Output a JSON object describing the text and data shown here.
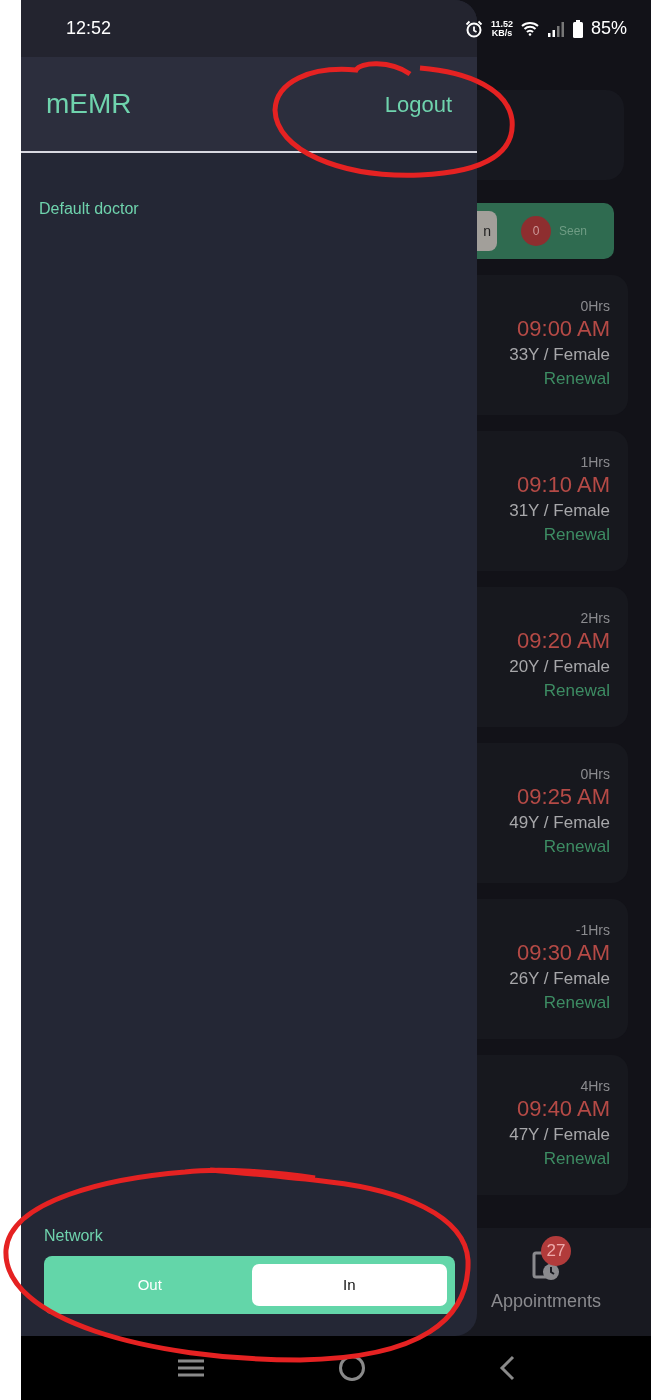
{
  "status_bar": {
    "time": "12:52",
    "net_speed_value": "11.52",
    "net_speed_unit": "KB/s",
    "battery": "85%"
  },
  "drawer": {
    "title": "mEMR",
    "logout": "Logout",
    "user": "Default doctor",
    "network": {
      "label": "Network",
      "options": [
        {
          "label": "Out",
          "selected": false
        },
        {
          "label": "In",
          "selected": true
        }
      ]
    }
  },
  "filters": [
    {
      "kind": "button",
      "label": "n"
    },
    {
      "kind": "counter",
      "count": "0",
      "label": "Seen"
    }
  ],
  "appointments": [
    {
      "hours": "0Hrs",
      "time": "09:00 AM",
      "patient": "33Y / Female",
      "visit": "Renewal"
    },
    {
      "hours": "1Hrs",
      "time": "09:10 AM",
      "patient": "31Y / Female",
      "visit": "Renewal"
    },
    {
      "hours": "2Hrs",
      "time": "09:20 AM",
      "patient": "20Y / Female",
      "visit": "Renewal"
    },
    {
      "hours": "0Hrs",
      "time": "09:25 AM",
      "patient": "49Y / Female",
      "visit": "Renewal"
    },
    {
      "hours": "-1Hrs",
      "time": "09:30 AM",
      "patient": "26Y / Female",
      "visit": "Renewal"
    },
    {
      "hours": "4Hrs",
      "time": "09:40 AM",
      "patient": "47Y / Female",
      "visit": "Renewal"
    }
  ],
  "bottom_nav": {
    "label": "Appointments",
    "badge": "27"
  }
}
